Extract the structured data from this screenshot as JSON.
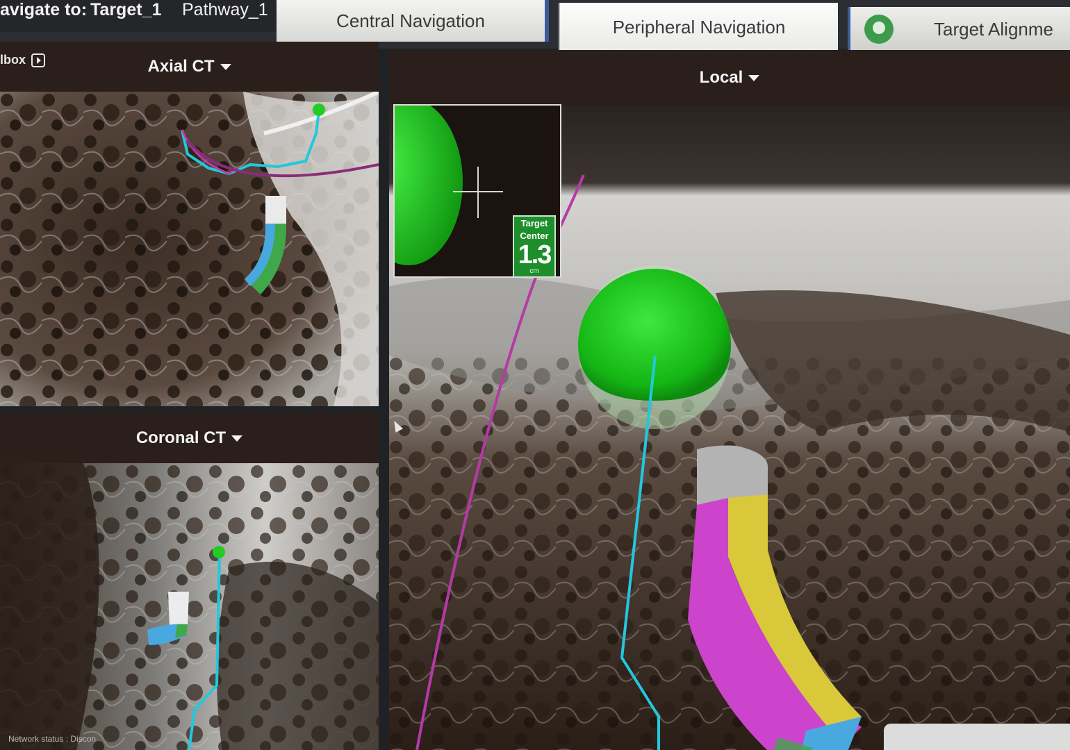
{
  "header": {
    "navigate_label": "avigate to:",
    "target_name": "Target_1",
    "pathway_name": "Pathway_1"
  },
  "tabs": [
    {
      "label": "Central Navigation",
      "active": false
    },
    {
      "label": "Peripheral Navigation",
      "active": true
    },
    {
      "label": "Target Alignme",
      "icon": "lung-icon",
      "active": false
    }
  ],
  "left_panel": {
    "toolbox_label": "lbox",
    "axial": {
      "view_label": "Axial CT"
    },
    "coronal": {
      "view_label": "Coronal CT"
    }
  },
  "local_panel": {
    "view_label": "Local",
    "inset": {
      "badge_label_1": "Target",
      "badge_label_2": "Center",
      "distance": "1.3",
      "unit": "cm"
    }
  },
  "status_bar": {
    "text": "Network status : Discon"
  },
  "colors": {
    "target": "#22cc22",
    "pathway": "#22c8dd",
    "catheter_magenta": "#cc44cc",
    "catheter_yellow": "#d8c83a",
    "catheter_blue": "#4aa8e0",
    "tab_accent": "#3b5c9a"
  }
}
